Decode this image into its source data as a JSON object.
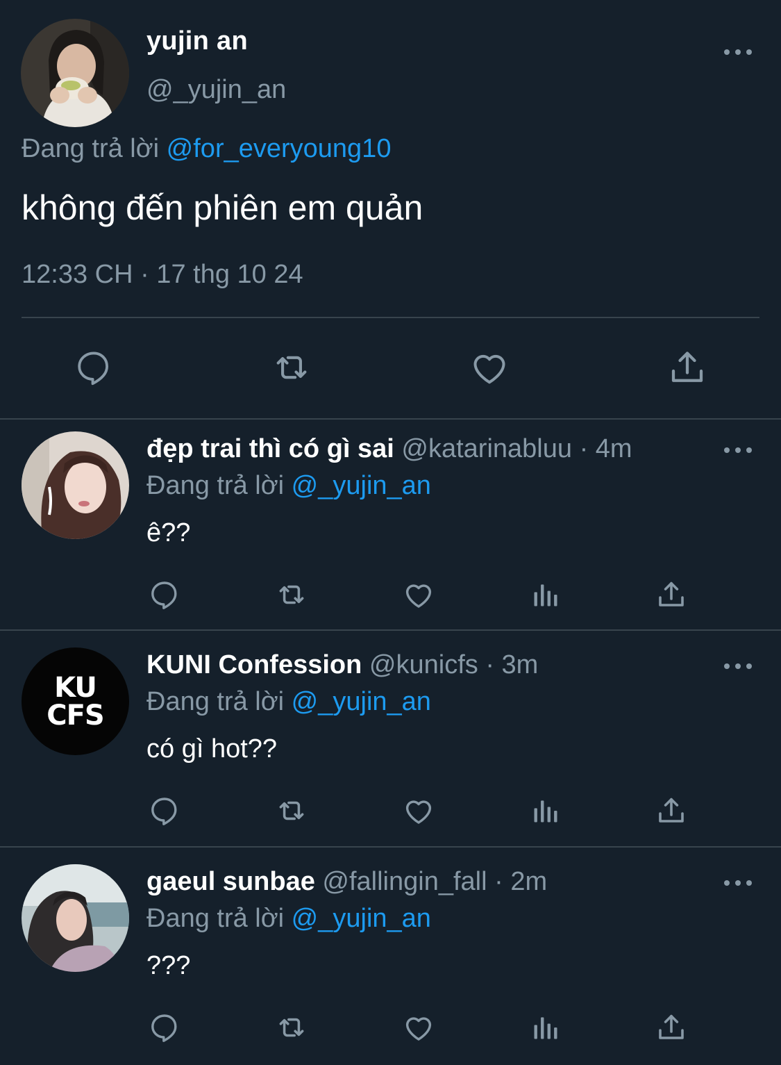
{
  "main_tweet": {
    "display_name": "yujin an",
    "handle": "@_yujin_an",
    "replying_prefix": "Đang trả lời",
    "replying_to": "@for_everyoung10",
    "text": "không đến phiên em quản",
    "timestamp": "12:33 CH · 17 thg 10 24",
    "actions": [
      "reply-icon",
      "retweet-icon",
      "like-icon",
      "share-icon"
    ]
  },
  "replies": [
    {
      "display_name": "đẹp trai thì có gì sai",
      "handle": "@katarinabluu",
      "time": "4m",
      "replying_prefix": "Đang trả lời",
      "replying_to": "@_yujin_an",
      "text": "ê??"
    },
    {
      "display_name": "KUNI Confession",
      "handle": "@kunicfs",
      "time": "3m",
      "replying_prefix": "Đang trả lời",
      "replying_to": "@_yujin_an",
      "text": "có gì hot??",
      "avatar_text_line1": "KU",
      "avatar_text_line2": "CFS"
    },
    {
      "display_name": "gaeul sunbae",
      "handle": "@fallingin_fall",
      "time": "2m",
      "replying_prefix": "Đang trả lời",
      "replying_to": "@_yujin_an",
      "text": "???"
    }
  ],
  "separator": " · ",
  "colors": {
    "background": "#15202b",
    "secondary_text": "#8899a6",
    "link": "#1d9bf0",
    "divider": "#38444d"
  }
}
